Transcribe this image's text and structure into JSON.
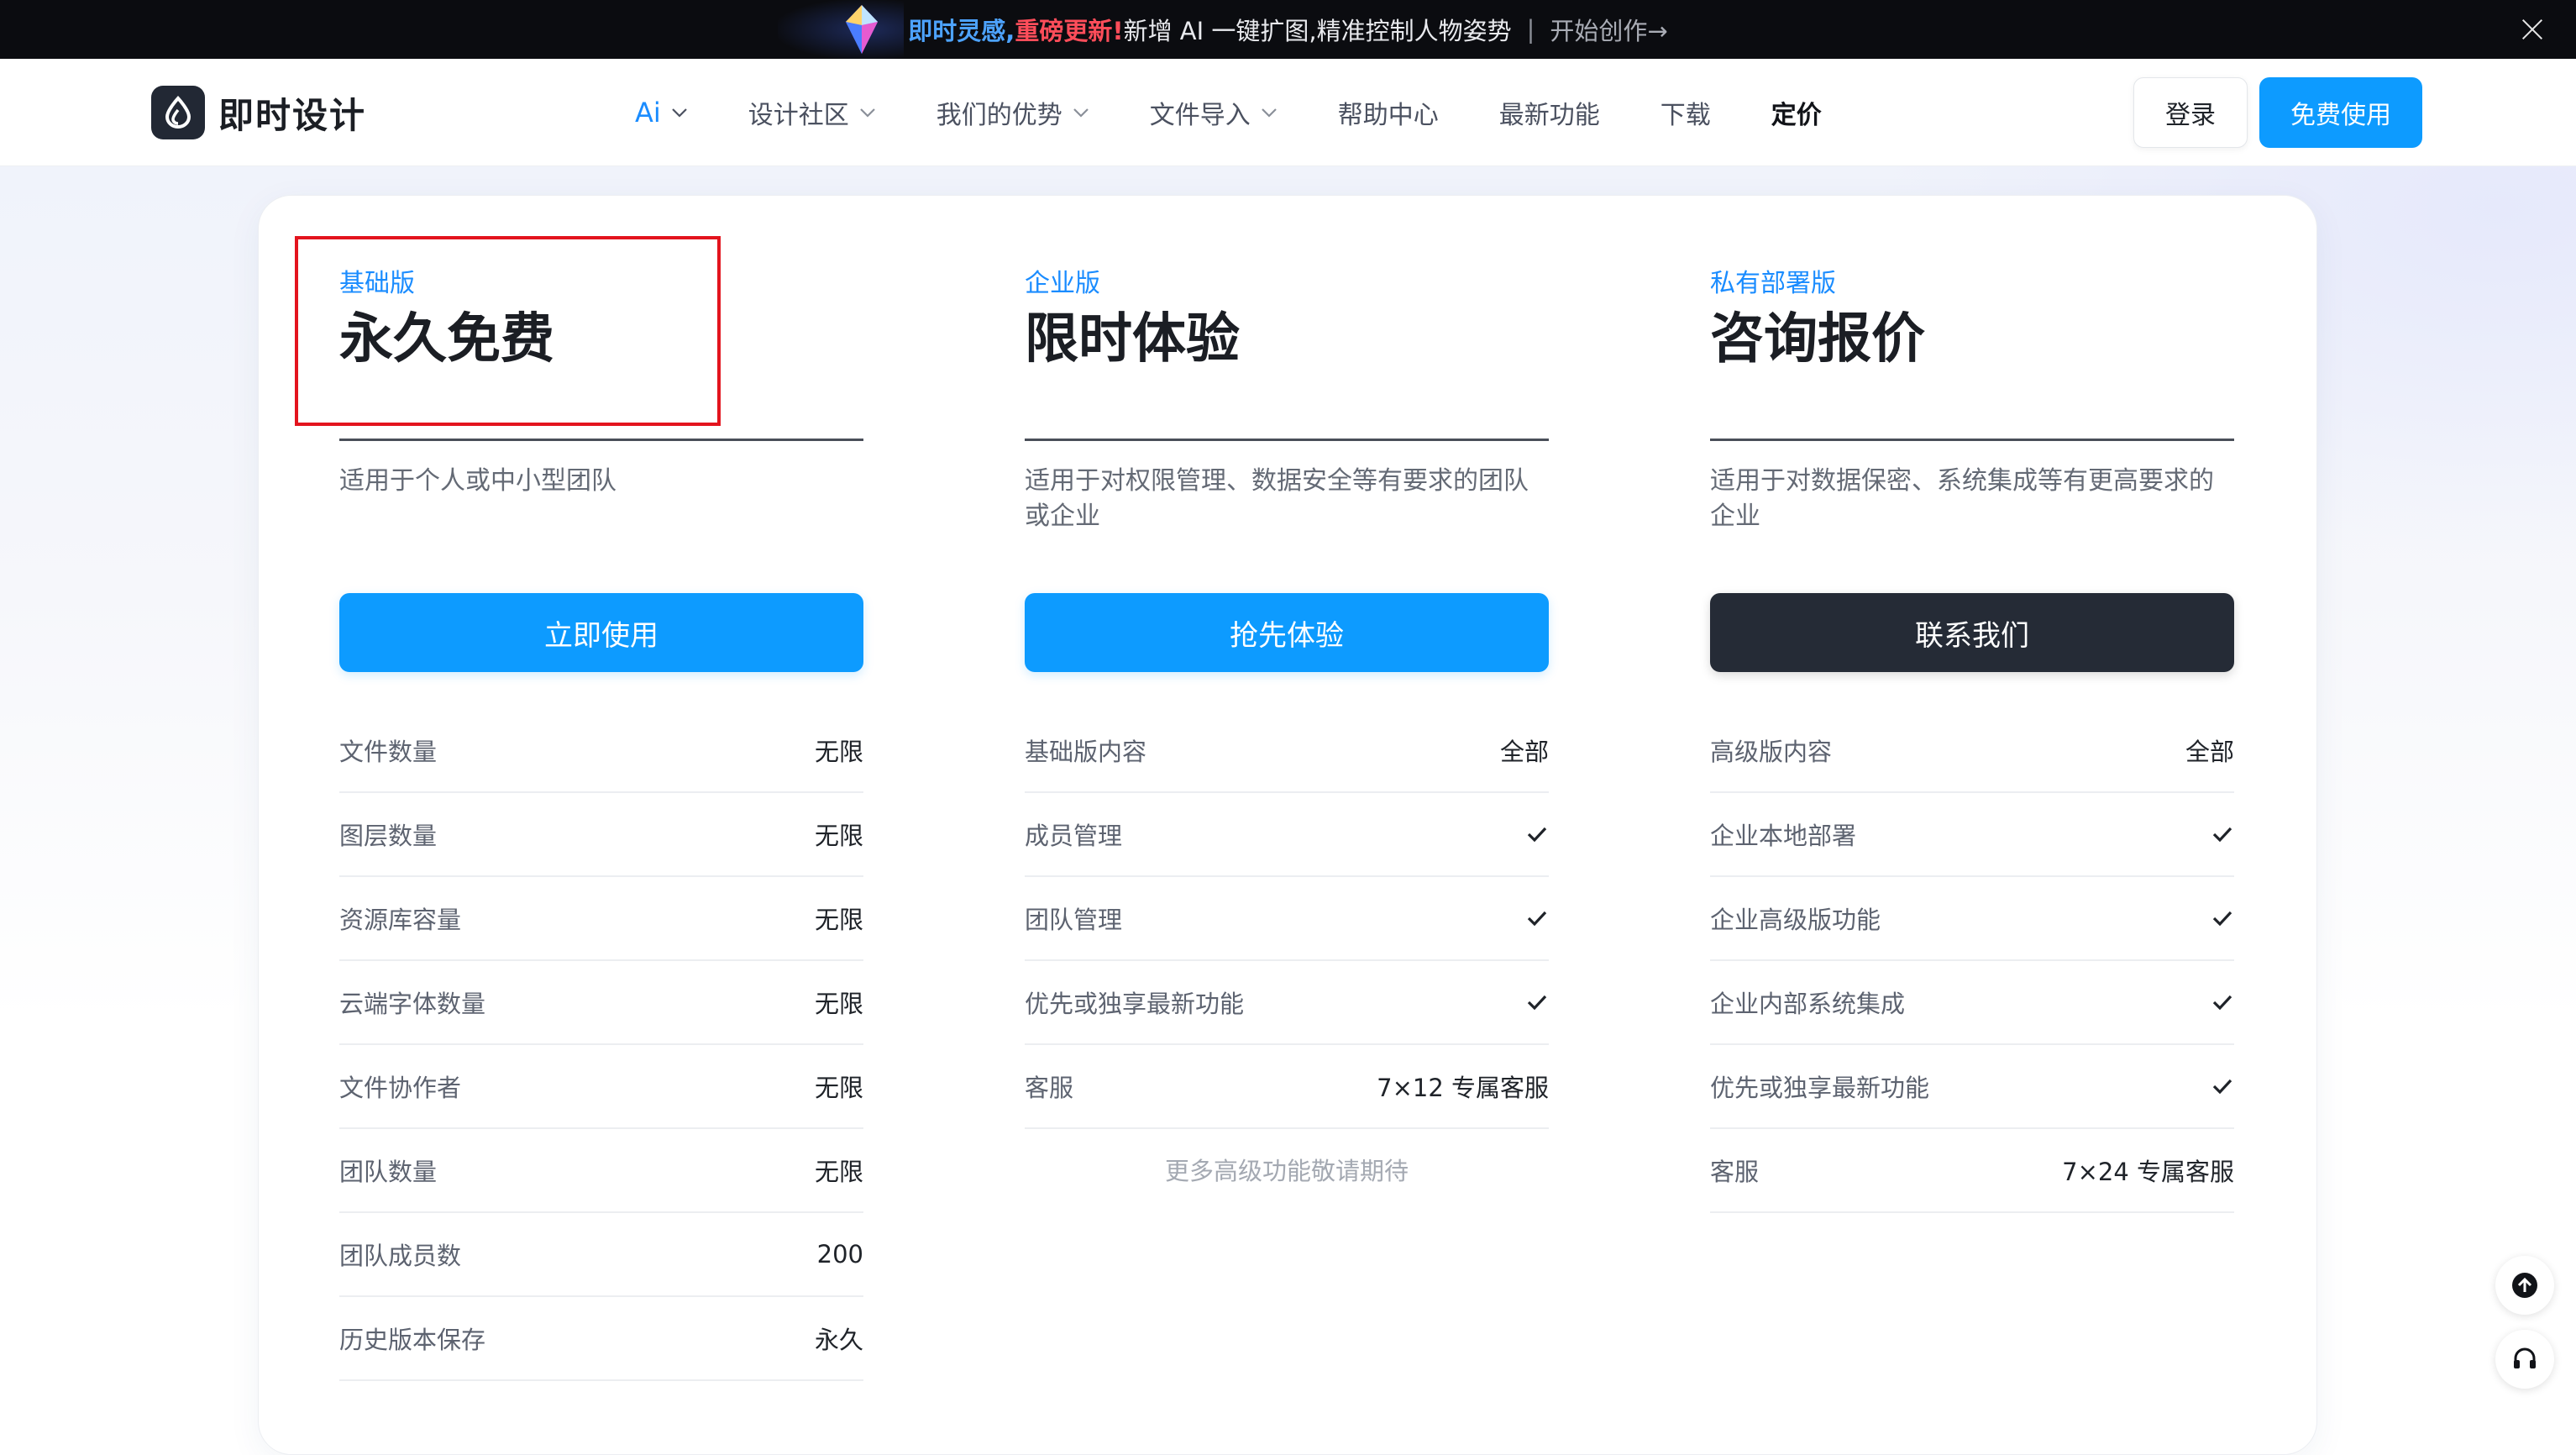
{
  "banner": {
    "part1": "即时灵感,",
    "part2": "重磅更新!",
    "part3": "新增 AI 一键扩图,精准控制人物姿势",
    "separator": "|",
    "cta": "开始创作→"
  },
  "nav": {
    "logo_text": "即时设计",
    "items": [
      {
        "label": "Ai",
        "has_dropdown": true
      },
      {
        "label": "设计社区",
        "has_dropdown": true
      },
      {
        "label": "我们的优势",
        "has_dropdown": true
      },
      {
        "label": "文件导入",
        "has_dropdown": true
      },
      {
        "label": "帮助中心",
        "has_dropdown": false
      },
      {
        "label": "最新功能",
        "has_dropdown": false
      },
      {
        "label": "下载",
        "has_dropdown": false
      },
      {
        "label": "定价",
        "has_dropdown": false
      }
    ],
    "login_label": "登录",
    "free_label": "免费使用"
  },
  "plans": [
    {
      "tier": "基础版",
      "price": "永久免费",
      "desc": "适用于个人或中小型团队",
      "button": "立即使用",
      "features": [
        {
          "name": "文件数量",
          "value": "无限"
        },
        {
          "name": "图层数量",
          "value": "无限"
        },
        {
          "name": "资源库容量",
          "value": "无限"
        },
        {
          "name": "云端字体数量",
          "value": "无限"
        },
        {
          "name": "文件协作者",
          "value": "无限"
        },
        {
          "name": "团队数量",
          "value": "无限"
        },
        {
          "name": "团队成员数",
          "value": "200"
        },
        {
          "name": "历史版本保存",
          "value": "永久"
        }
      ]
    },
    {
      "tier": "企业版",
      "price": "限时体验",
      "desc": "适用于对权限管理、数据安全等有要求的团队或企业",
      "button": "抢先体验",
      "features": [
        {
          "name": "基础版内容",
          "value": "全部"
        },
        {
          "name": "成员管理",
          "value": ""
        },
        {
          "name": "团队管理",
          "value": ""
        },
        {
          "name": "优先或独享最新功能",
          "value": ""
        },
        {
          "name": "客服",
          "value": "7×12 专属客服"
        }
      ],
      "note": "更多高级功能敬请期待"
    },
    {
      "tier": "私有部署版",
      "price": "咨询报价",
      "desc": "适用于对数据保密、系统集成等有更高要求的企业",
      "button": "联系我们",
      "features": [
        {
          "name": "高级版内容",
          "value": "全部"
        },
        {
          "name": "企业本地部署",
          "value": ""
        },
        {
          "name": "企业高级版功能",
          "value": ""
        },
        {
          "name": "企业内部系统集成",
          "value": ""
        },
        {
          "name": "优先或独享最新功能",
          "value": ""
        },
        {
          "name": "客服",
          "value": "7×24 专属客服"
        }
      ]
    }
  ],
  "colors": {
    "accent": "#0d9bff",
    "dark_button": "#252b36",
    "highlight": "#e3141e",
    "banner_bg": "#0b0c10"
  }
}
